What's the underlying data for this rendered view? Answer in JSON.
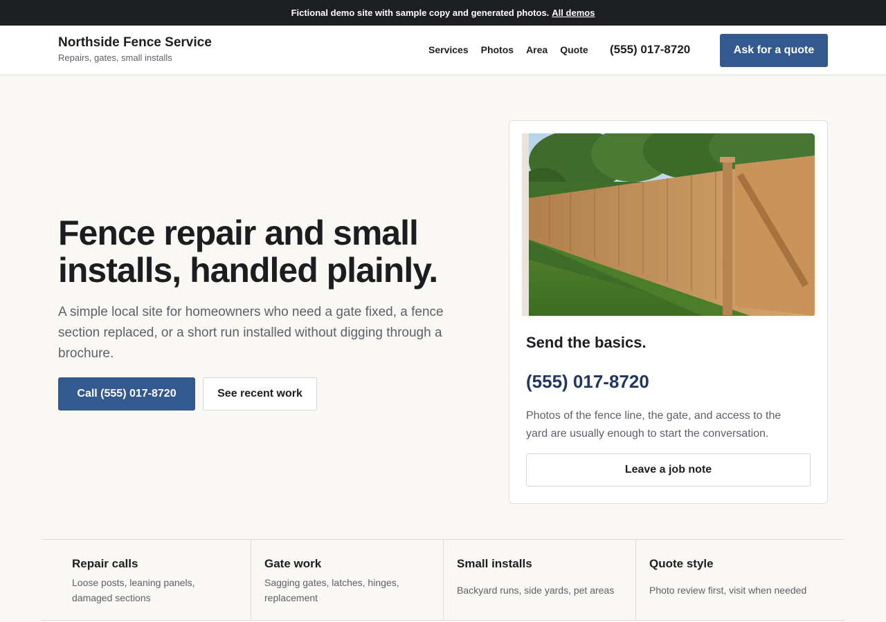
{
  "topbar": {
    "notice": "Fictional demo site with sample copy and generated photos.",
    "link": "All demos"
  },
  "header": {
    "brand_name": "Northside Fence Service",
    "brand_tagline": "Repairs, gates, small installs",
    "nav": [
      "Services",
      "Photos",
      "Area",
      "Quote"
    ],
    "phone": "(555) 017-8720",
    "cta": "Ask for a quote"
  },
  "hero": {
    "title": "Fence repair and small installs, handled plainly.",
    "subtitle": "A simple local site for homeowners who need a gate fixed, a fence section replaced, or a short run installed without digging through a brochure.",
    "primary_cta": "Call (555) 017-8720",
    "secondary_cta": "See recent work"
  },
  "card": {
    "title": "Send the basics.",
    "phone": "(555) 017-8720",
    "description": "Photos of the fence line, the gate, and access to the yard are usually enough to start the conversation.",
    "button": "Leave a job note"
  },
  "features": [
    {
      "title": "Repair calls",
      "text": "Loose posts, leaning panels, damaged sections"
    },
    {
      "title": "Gate work",
      "text": "Sagging gates, latches, hinges, replacement"
    },
    {
      "title": "Small installs",
      "text": "Backyard runs, side yards, pet areas"
    },
    {
      "title": "Quote style",
      "text": "Photo review first, visit when needed"
    }
  ],
  "colors": {
    "accent": "#34598f",
    "phone_text": "#22375f",
    "topbar": "#1d1e22",
    "page_bg": "#f9f8f5"
  }
}
